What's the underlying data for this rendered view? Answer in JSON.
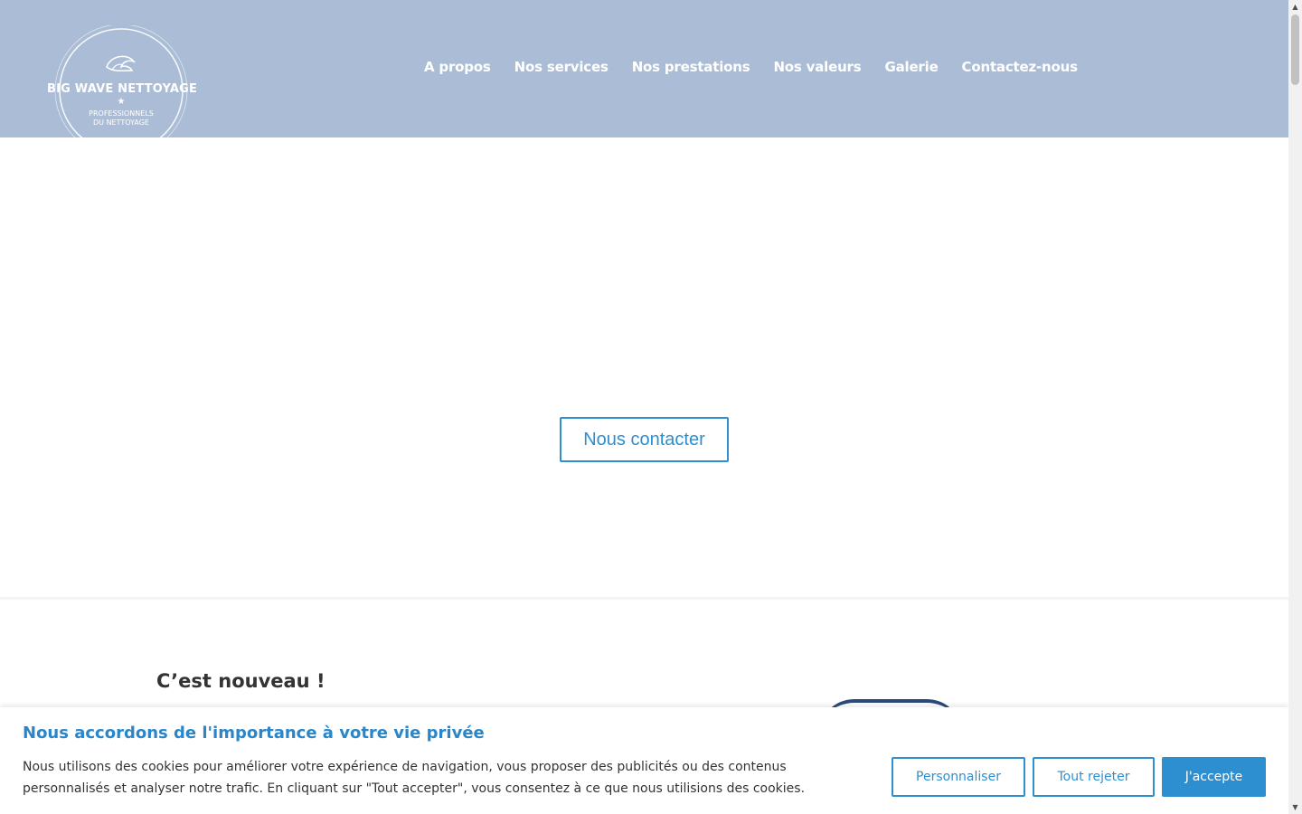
{
  "header": {
    "logo": {
      "title": "BIG WAVE NETTOYAGE",
      "star": "★",
      "subtitle_line1": "PROFESSIONNELS",
      "subtitle_line2": "DU NETTOYAGE"
    },
    "nav": [
      {
        "label": "A propos"
      },
      {
        "label": "Nos services"
      },
      {
        "label": "Nos prestations"
      },
      {
        "label": "Nos valeurs"
      },
      {
        "label": "Galerie"
      },
      {
        "label": "Contactez-nous"
      }
    ],
    "background_color": "#abbdd6"
  },
  "hero": {
    "cta_label": "Nous contacter"
  },
  "news": {
    "title": "C’est nouveau !"
  },
  "cookie_banner": {
    "title": "Nous accordons de l'importance à votre vie privée",
    "text": "Nous utilisons des cookies pour améliorer votre expérience de navigation, vous proposer des publicités ou des contenus personnalisés et analyser notre trafic. En cliquant sur \"Tout accepter\", vous consentez à ce que nous utilisions des cookies.",
    "buttons": {
      "customize": "Personnaliser",
      "reject": "Tout rejeter",
      "accept": "J'accepte"
    },
    "accent_color": "#2e8fd0"
  },
  "scrollbar": {
    "up_icon": "▲",
    "down_icon": "▼"
  }
}
